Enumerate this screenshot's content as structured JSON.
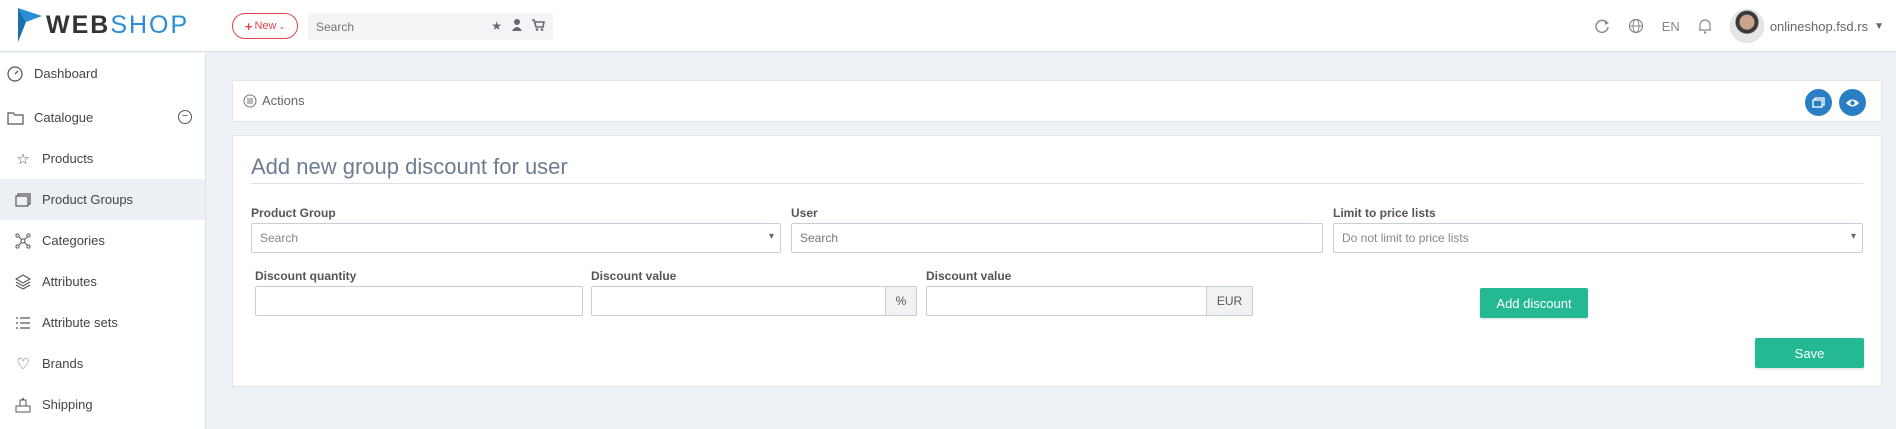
{
  "header": {
    "logo_web": "WEB",
    "logo_shop": "SHOP",
    "new_label": "New",
    "search_placeholder": "Search",
    "language": "EN",
    "shop_name": "onlineshop.fsd.rs"
  },
  "sidebar": {
    "items": [
      {
        "label": "Dashboard"
      },
      {
        "label": "Catalogue"
      },
      {
        "label": "Products"
      },
      {
        "label": "Product Groups"
      },
      {
        "label": "Categories"
      },
      {
        "label": "Attributes"
      },
      {
        "label": "Attribute sets"
      },
      {
        "label": "Brands"
      },
      {
        "label": "Shipping"
      }
    ]
  },
  "actions": {
    "label": "Actions"
  },
  "form": {
    "title": "Add new group discount for user",
    "product_group": {
      "label": "Product Group",
      "placeholder": "Search"
    },
    "user": {
      "label": "User",
      "placeholder": "Search"
    },
    "price_lists": {
      "label": "Limit to price lists",
      "value": "Do not limit to price lists"
    },
    "discount_quantity": {
      "label": "Discount quantity",
      "value": ""
    },
    "discount_percent": {
      "label": "Discount value",
      "addon": "%"
    },
    "discount_amount": {
      "label": "Discount value",
      "addon": "EUR"
    },
    "add_discount": "Add discount",
    "save": "Save"
  },
  "colors": {
    "accent_blue": "#2a7fc4",
    "green": "#24b992",
    "red": "#e0474c"
  }
}
